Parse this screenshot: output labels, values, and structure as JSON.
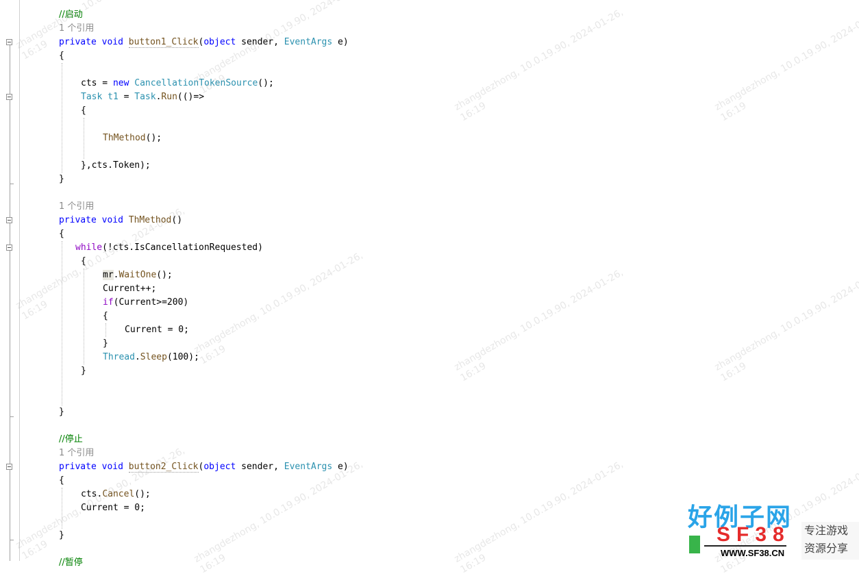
{
  "editor": {
    "lines": [
      {
        "id": "comment-start",
        "segments": [
          {
            "t": "//启动",
            "c": "comment"
          }
        ]
      },
      {
        "id": "codelens-1",
        "segments": [
          {
            "t": "1 个引用",
            "c": "codelens"
          }
        ]
      },
      {
        "id": "button1-sig",
        "segments": [
          {
            "t": "private",
            "c": "kw"
          },
          {
            "t": " "
          },
          {
            "t": "void",
            "c": "kw"
          },
          {
            "t": " "
          },
          {
            "t": "button1_Click",
            "c": "method squiggle"
          },
          {
            "t": "("
          },
          {
            "t": "object",
            "c": "kw"
          },
          {
            "t": " sender, "
          },
          {
            "t": "EventArgs",
            "c": "type"
          },
          {
            "t": " e)"
          }
        ]
      },
      {
        "id": "brace-open-1",
        "segments": [
          {
            "t": "{"
          }
        ]
      },
      {
        "id": "blank-1",
        "segments": []
      },
      {
        "id": "cts-new",
        "segments": [
          {
            "t": "cts = "
          },
          {
            "t": "new",
            "c": "kw"
          },
          {
            "t": " "
          },
          {
            "t": "CancellationTokenSource",
            "c": "type"
          },
          {
            "t": "();"
          }
        ]
      },
      {
        "id": "task-run",
        "segments": [
          {
            "t": "Task",
            "c": "type"
          },
          {
            "t": " "
          },
          {
            "t": "t1",
            "c": "type"
          },
          {
            "t": " = "
          },
          {
            "t": "Task",
            "c": "type"
          },
          {
            "t": "."
          },
          {
            "t": "Run",
            "c": "method"
          },
          {
            "t": "(()=>"
          }
        ]
      },
      {
        "id": "lambda-open",
        "segments": [
          {
            "t": "{"
          }
        ]
      },
      {
        "id": "blank-2",
        "segments": []
      },
      {
        "id": "call-thmethod",
        "segments": [
          {
            "t": "ThMethod",
            "c": "method"
          },
          {
            "t": "();"
          }
        ]
      },
      {
        "id": "blank-3",
        "segments": []
      },
      {
        "id": "lambda-close",
        "segments": [
          {
            "t": "},cts.Token);"
          }
        ]
      },
      {
        "id": "brace-close-1",
        "segments": [
          {
            "t": "}"
          }
        ]
      },
      {
        "id": "blank-4",
        "segments": []
      },
      {
        "id": "codelens-2",
        "segments": [
          {
            "t": "1 个引用",
            "c": "codelens"
          }
        ]
      },
      {
        "id": "thmethod-sig",
        "segments": [
          {
            "t": "private",
            "c": "kw"
          },
          {
            "t": " "
          },
          {
            "t": "void",
            "c": "kw"
          },
          {
            "t": " "
          },
          {
            "t": "ThMethod",
            "c": "method"
          },
          {
            "t": "()"
          }
        ]
      },
      {
        "id": "brace-open-2",
        "segments": [
          {
            "t": "{"
          }
        ]
      },
      {
        "id": "while-line",
        "segments": [
          {
            "t": "while",
            "c": "kw2"
          },
          {
            "t": "(!cts.IsCancellationRequested)"
          }
        ]
      },
      {
        "id": "while-open",
        "segments": [
          {
            "t": "{"
          }
        ]
      },
      {
        "id": "waitone",
        "segments": [
          {
            "t": "mr",
            "c": "hl"
          },
          {
            "t": "."
          },
          {
            "t": "WaitOne",
            "c": "method"
          },
          {
            "t": "();"
          }
        ]
      },
      {
        "id": "current-inc",
        "segments": [
          {
            "t": "Current++;"
          }
        ]
      },
      {
        "id": "if-line",
        "segments": [
          {
            "t": "if",
            "c": "kw2"
          },
          {
            "t": "(Current>=200)"
          }
        ]
      },
      {
        "id": "if-open",
        "segments": [
          {
            "t": "{"
          }
        ]
      },
      {
        "id": "current-reset",
        "segments": [
          {
            "t": "Current = 0;"
          }
        ]
      },
      {
        "id": "if-close",
        "segments": [
          {
            "t": "}"
          }
        ]
      },
      {
        "id": "sleep",
        "segments": [
          {
            "t": "Thread",
            "c": "type"
          },
          {
            "t": "."
          },
          {
            "t": "Sleep",
            "c": "method"
          },
          {
            "t": "(100);"
          }
        ]
      },
      {
        "id": "while-close",
        "segments": [
          {
            "t": "}"
          }
        ]
      },
      {
        "id": "blank-5",
        "segments": []
      },
      {
        "id": "blank-6",
        "segments": []
      },
      {
        "id": "brace-close-2",
        "segments": [
          {
            "t": "}"
          }
        ]
      },
      {
        "id": "blank-7",
        "segments": []
      },
      {
        "id": "comment-stop",
        "segments": [
          {
            "t": "//停止",
            "c": "comment"
          }
        ]
      },
      {
        "id": "codelens-3",
        "segments": [
          {
            "t": "1 个引用",
            "c": "codelens"
          }
        ]
      },
      {
        "id": "button2-sig",
        "segments": [
          {
            "t": "private",
            "c": "kw"
          },
          {
            "t": " "
          },
          {
            "t": "void",
            "c": "kw"
          },
          {
            "t": " "
          },
          {
            "t": "button2_Click",
            "c": "method squiggle"
          },
          {
            "t": "("
          },
          {
            "t": "object",
            "c": "kw"
          },
          {
            "t": " sender, "
          },
          {
            "t": "EventArgs",
            "c": "type"
          },
          {
            "t": " e)"
          }
        ]
      },
      {
        "id": "brace-open-3",
        "segments": [
          {
            "t": "{"
          }
        ]
      },
      {
        "id": "cts-cancel",
        "segments": [
          {
            "t": "cts."
          },
          {
            "t": "Cancel",
            "c": "method"
          },
          {
            "t": "();"
          }
        ]
      },
      {
        "id": "current-zero",
        "segments": [
          {
            "t": "Current = 0;"
          }
        ]
      },
      {
        "id": "blank-8",
        "segments": []
      },
      {
        "id": "brace-close-3",
        "segments": [
          {
            "t": "}"
          }
        ]
      },
      {
        "id": "blank-9",
        "segments": []
      },
      {
        "id": "comment-pause",
        "segments": [
          {
            "t": "//暂停",
            "c": "comment"
          }
        ]
      }
    ]
  },
  "watermark": {
    "user": "zhangdezhong, 10.0.19.90, 2024-01-26,",
    "time": "16:19"
  },
  "logo": {
    "cn": "好例子网",
    "sf": "SF38",
    "url": "WWW.SF38.CN",
    "tag1": "专注游戏",
    "tag2": "资源分享"
  },
  "colors": {
    "keyword": "#0000ff",
    "control": "#8f08c4",
    "type": "#2b91af",
    "method": "#74531f",
    "comment": "#008000",
    "codelens": "#8a8a8a"
  }
}
